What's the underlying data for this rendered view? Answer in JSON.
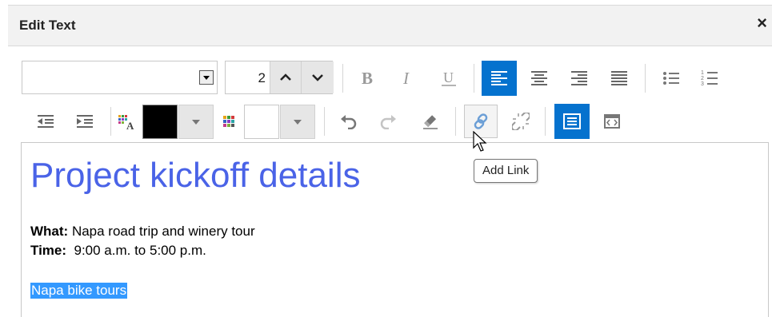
{
  "dialog": {
    "title": "Edit Text",
    "close_label": "×"
  },
  "toolbar": {
    "font_name": "",
    "font_size": "2",
    "tooltip": "Add Link",
    "font_color": "#000000",
    "background_color": "#ffffff",
    "accent": "#0572ce"
  },
  "content": {
    "heading": "Project kickoff details",
    "what_label": "What:",
    "what_value": " Napa road trip and winery tour",
    "time_label": "Time:",
    "time_value": "  9:00 a.m. to 5:00 p.m.",
    "link_text": "Napa bike tours"
  }
}
